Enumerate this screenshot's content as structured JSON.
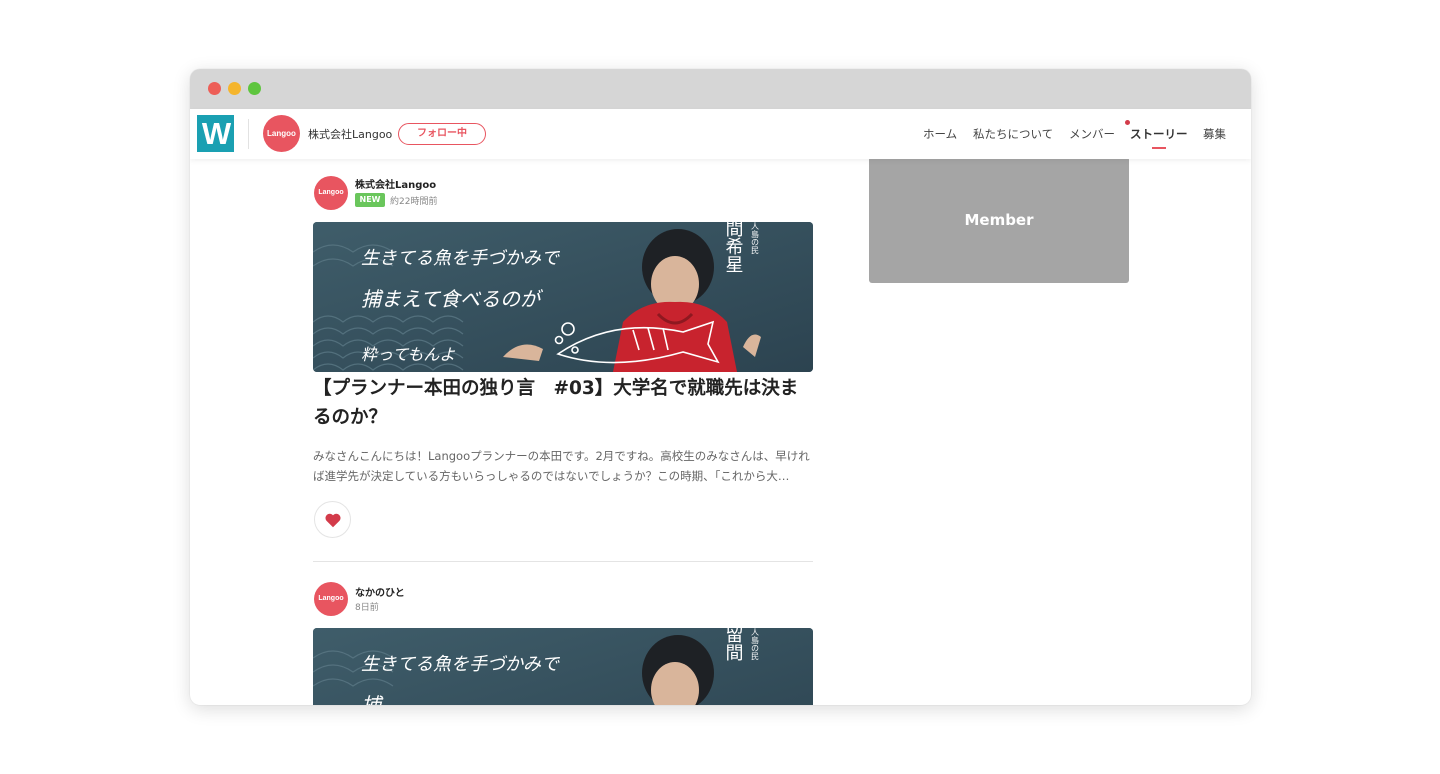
{
  "header": {
    "company_avatar_text": "Langoo",
    "company_name": "株式会社Langoo",
    "follow_label": "フォロー中",
    "nav": [
      "ホーム",
      "私たちについて",
      "メンバー",
      "ストーリー",
      "募集"
    ],
    "active_nav": "ストーリー"
  },
  "posts": [
    {
      "avatar_text": "Langoo",
      "author": "株式会社Langoo",
      "badge": "NEW",
      "time": "約22時間前",
      "banner_text": {
        "line1": "生きてる魚を手づかみで",
        "line2": "捕まえて食べるのが",
        "line3": "粋ってもんよ",
        "vertical_small": "無人島の民",
        "vertical_large": "比留間希星"
      },
      "title": "【プランナー本田の独り言　#03】大学名で就職先は決まるのか？",
      "excerpt": "みなさんこんにちは！Langooプランナーの本田です。2月ですね。高校生のみなさんは、早ければ進学先が決定している方もいらっしゃるのではないでしょうか？この時期、「これから大…"
    },
    {
      "avatar_text": "Langoo",
      "author": "なかのひと",
      "time": "8日前",
      "banner_text": {
        "line1": "生きてる魚を手づかみで",
        "line2": "捕",
        "vertical_small": "無人島の民",
        "vertical_large": "比留間"
      }
    }
  ],
  "sidebar": {
    "member_label": "Member"
  },
  "colors": {
    "brand": "#e85560",
    "badge": "#6ac65c",
    "logo": "#1aa0b2",
    "banner": "#35505d",
    "hoodie": "#c8232e"
  },
  "icons": {
    "like": "heart-icon",
    "logo": "w-logo-icon"
  }
}
